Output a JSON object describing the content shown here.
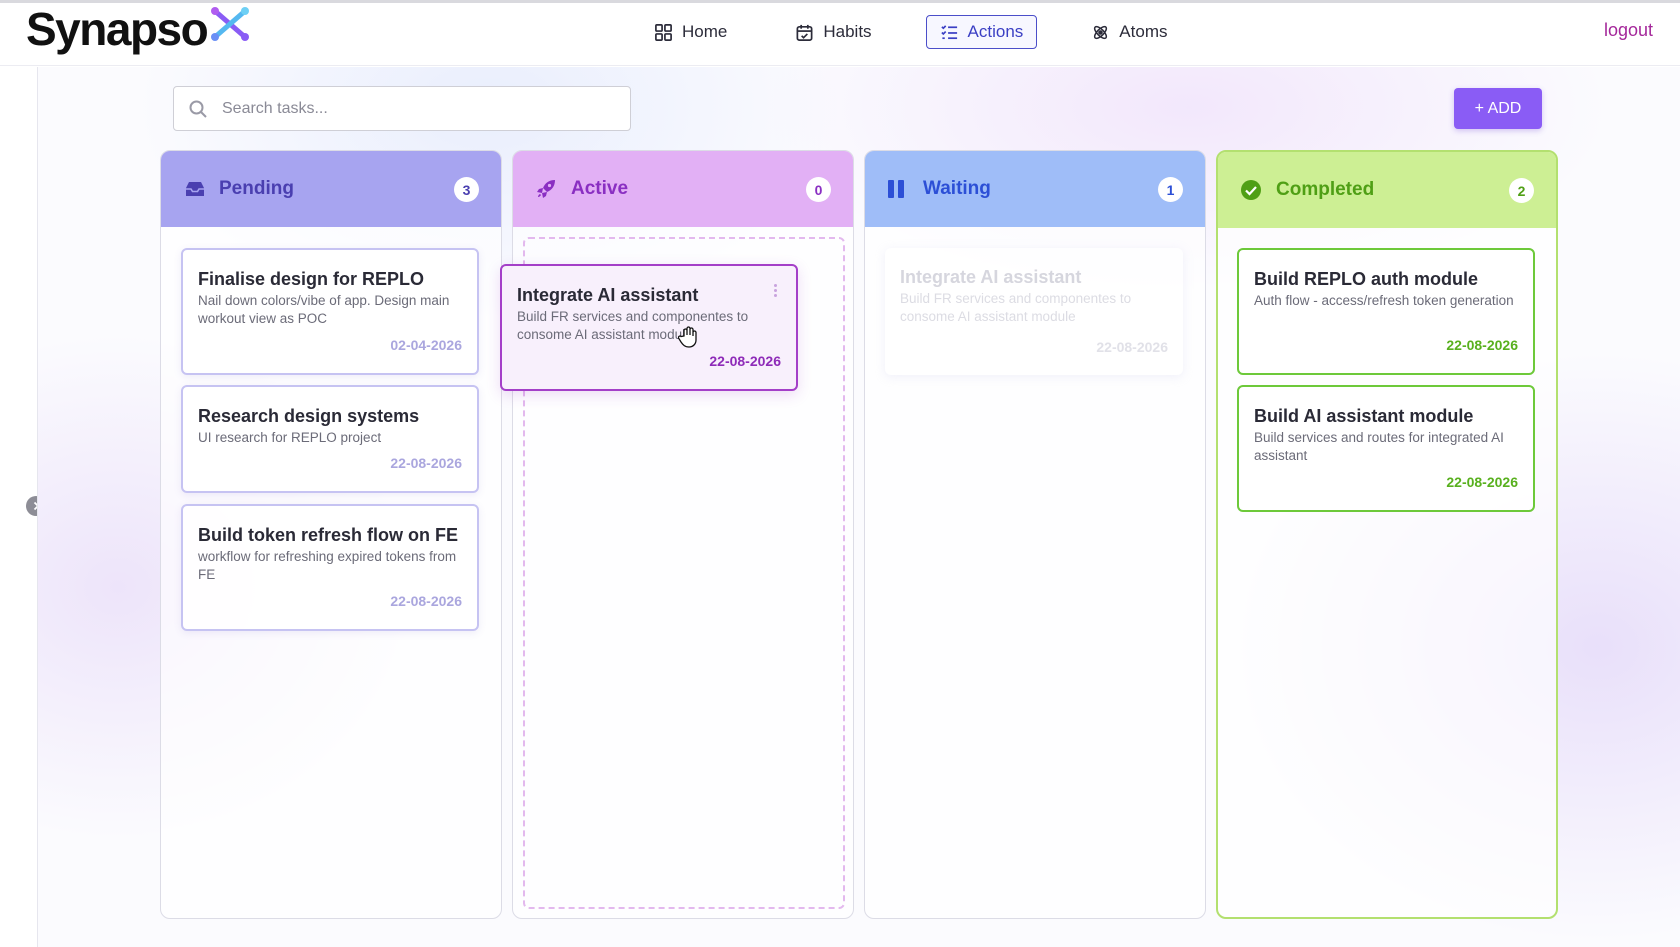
{
  "app": {
    "name": "Synapso"
  },
  "nav": {
    "items": [
      {
        "label": "Home",
        "icon": "grid-icon"
      },
      {
        "label": "Habits",
        "icon": "calendar-icon"
      },
      {
        "label": "Actions",
        "icon": "checklist-icon",
        "active": true
      },
      {
        "label": "Atoms",
        "icon": "atom-icon"
      }
    ],
    "logout_label": "logout"
  },
  "search": {
    "placeholder": "Search tasks..."
  },
  "toolbar": {
    "add_label": "+ ADD"
  },
  "columns": [
    {
      "title": "Pending",
      "count": "3",
      "icon": "inbox-tray-icon",
      "cards": [
        {
          "title": "Finalise design for REPLO",
          "description": "Nail down colors/vibe of app. Design main workout view as POC",
          "date": "02-04-2026"
        },
        {
          "title": "Research design systems",
          "description": "UI research for REPLO project",
          "date": "22-08-2026"
        },
        {
          "title": "Build token refresh flow on FE",
          "description": "workflow for refreshing expired tokens from FE",
          "date": "22-08-2026"
        }
      ]
    },
    {
      "title": "Active",
      "count": "0",
      "icon": "rocket-icon",
      "dragging_card": {
        "title": "Integrate AI assistant",
        "description": "Build FR services and componentes to consome AI assistant module",
        "date": "22-08-2026"
      }
    },
    {
      "title": "Waiting",
      "count": "1",
      "icon": "pause-icon",
      "cards": [
        {
          "title": "Integrate AI assistant",
          "description": "Build FR services and componentes to consome AI assistant module",
          "date": "22-08-2026"
        }
      ]
    },
    {
      "title": "Completed",
      "count": "2",
      "icon": "check-circle-icon",
      "cards": [
        {
          "title": "Build REPLO auth module",
          "description": "Auth flow - access/refresh token generation",
          "date": "22-08-2026"
        },
        {
          "title": "Build AI assistant module",
          "description": "Build services and routes for integrated AI assistant",
          "date": "22-08-2026"
        }
      ]
    }
  ],
  "colors": {
    "pending": "#a7a4f0",
    "active": "#e2b0f5",
    "waiting": "#9fbdf8",
    "completed": "#cdef94",
    "add_button": "#8a5cf5",
    "logout": "#a4279a",
    "nav_active": "#4b4ec9"
  }
}
